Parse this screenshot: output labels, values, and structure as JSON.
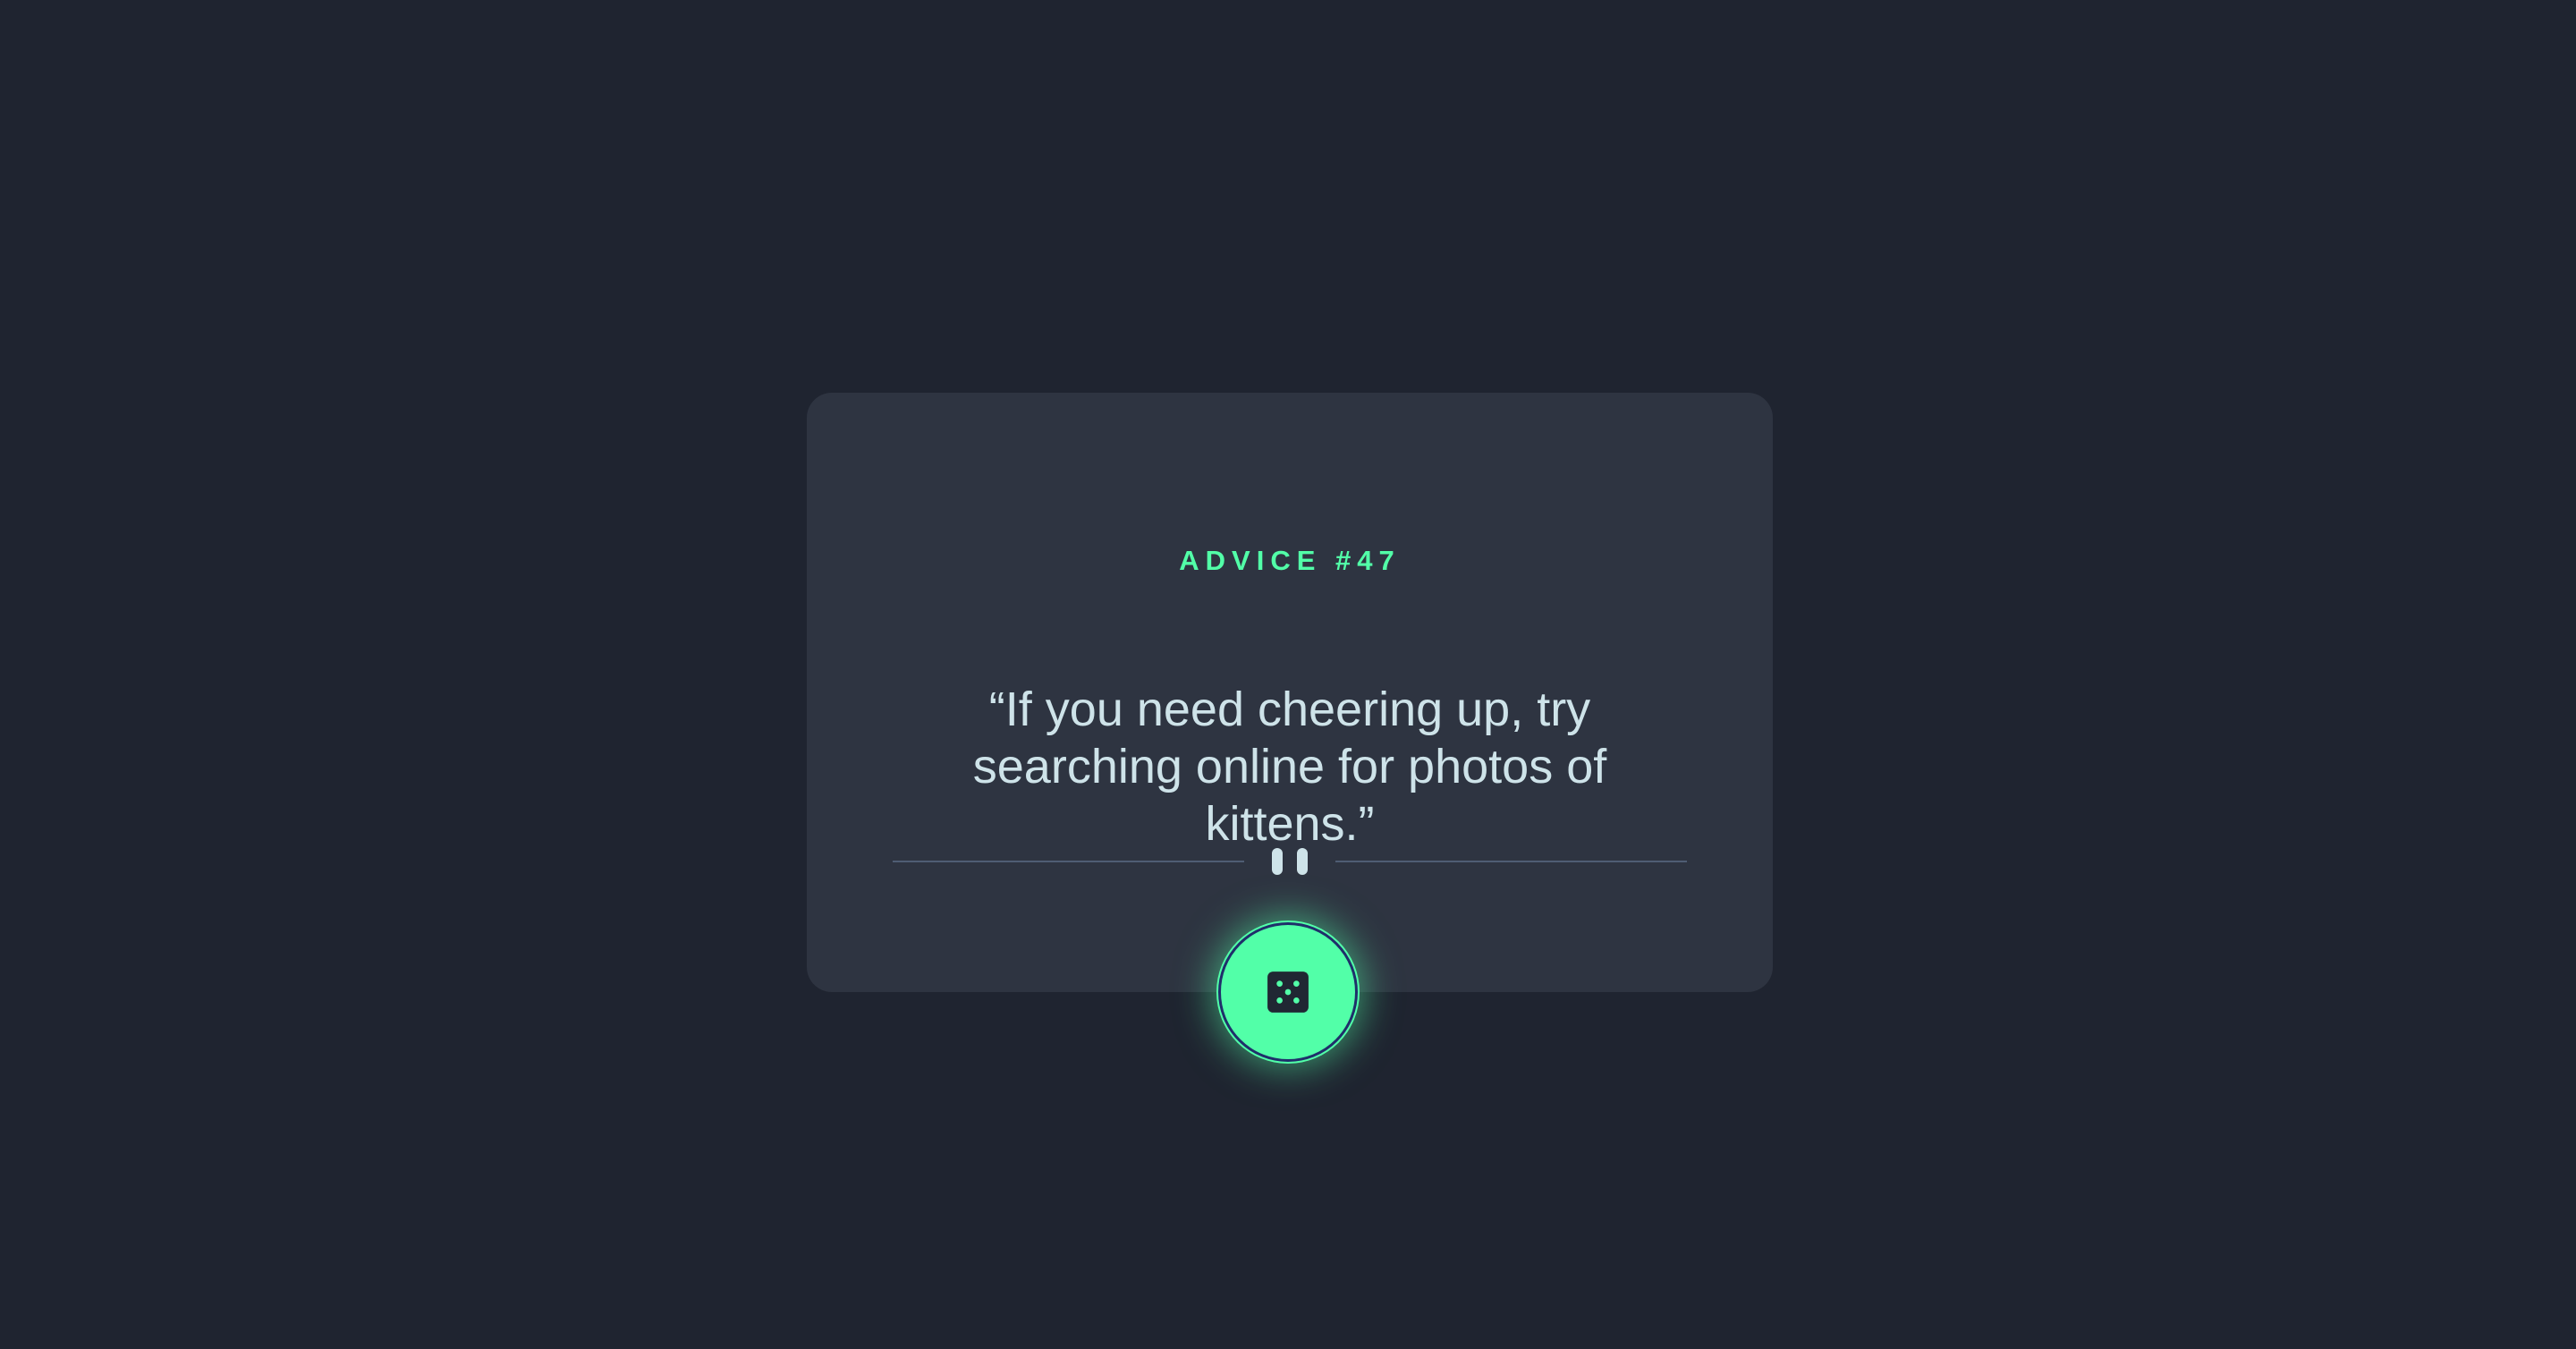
{
  "advice": {
    "id_label": "ADVICE #47",
    "text": "“If you need cheering up, try searching online for photos of kittens.”"
  },
  "divider": {
    "icon": "pause-icon"
  },
  "button": {
    "icon": "dice-icon",
    "accent_color": "#52ffa8"
  },
  "theme": {
    "background": "#1f2430",
    "card": "#2e3441",
    "text": "#cee3e9",
    "accent": "#52ffa8"
  }
}
